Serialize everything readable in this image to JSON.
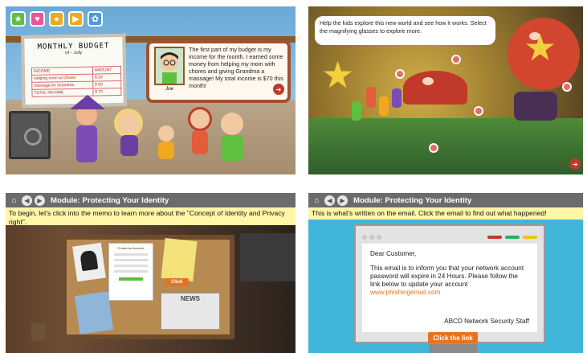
{
  "panel1": {
    "board_title": "MONTHLY BUDGET",
    "board_subtitle": "of - July",
    "table_rows": [
      [
        "INCOME",
        "AMOUNT"
      ],
      [
        "Helping mom w/ chores",
        "$ 20"
      ],
      [
        "massage for Grandma",
        "$ 50"
      ],
      [
        "TOTAL INCOME",
        "$ 70"
      ]
    ],
    "info_text": "The first part of my budget is my income for the month. I earned some money from helping my mom with chores and giving Grandma a massage! My total income is $70 this month!",
    "character_name": "Joe",
    "icons": [
      "star-icon",
      "heart-icon",
      "coin-icon",
      "play-icon",
      "gear-icon"
    ],
    "icon_colors": [
      "#5fbf3f",
      "#e6559c",
      "#f2a81d",
      "#f2a81d",
      "#4a9be0"
    ],
    "next_symbol": "➜"
  },
  "panel2": {
    "tip_text": "Help the kids explore this new world and see how it works. Select the magnifying glasses to explore more.",
    "next_symbol": "➜"
  },
  "panel3": {
    "module_title": "Module: Protecting Your Identity",
    "instruction": "To begin, let's click into the memo to learn more about the \"Concept of Identity and Privacy right\".",
    "form_title": "Create an Account",
    "click_label": "Click",
    "news_label": "NEWS"
  },
  "panel4": {
    "module_title": "Module: Protecting Your Identity",
    "instruction": "This is what's written on the email. Click the email to find out what happened!",
    "greeting": "Dear Customer,",
    "body": "This email is to inform you that your network account password will expire in 24 Hours. Please follow the link below to update your account",
    "link": "www.phishingemail.com",
    "signature": "ABCD Network Security Staff",
    "click_label": "Click the link",
    "pill_colors": [
      "#c0392b",
      "#27ae60",
      "#f1c40f"
    ]
  },
  "colors": {
    "header_gray": "#6b6b6b",
    "instruction_yellow": "#fff6a8",
    "accent_orange": "#e8731c"
  }
}
